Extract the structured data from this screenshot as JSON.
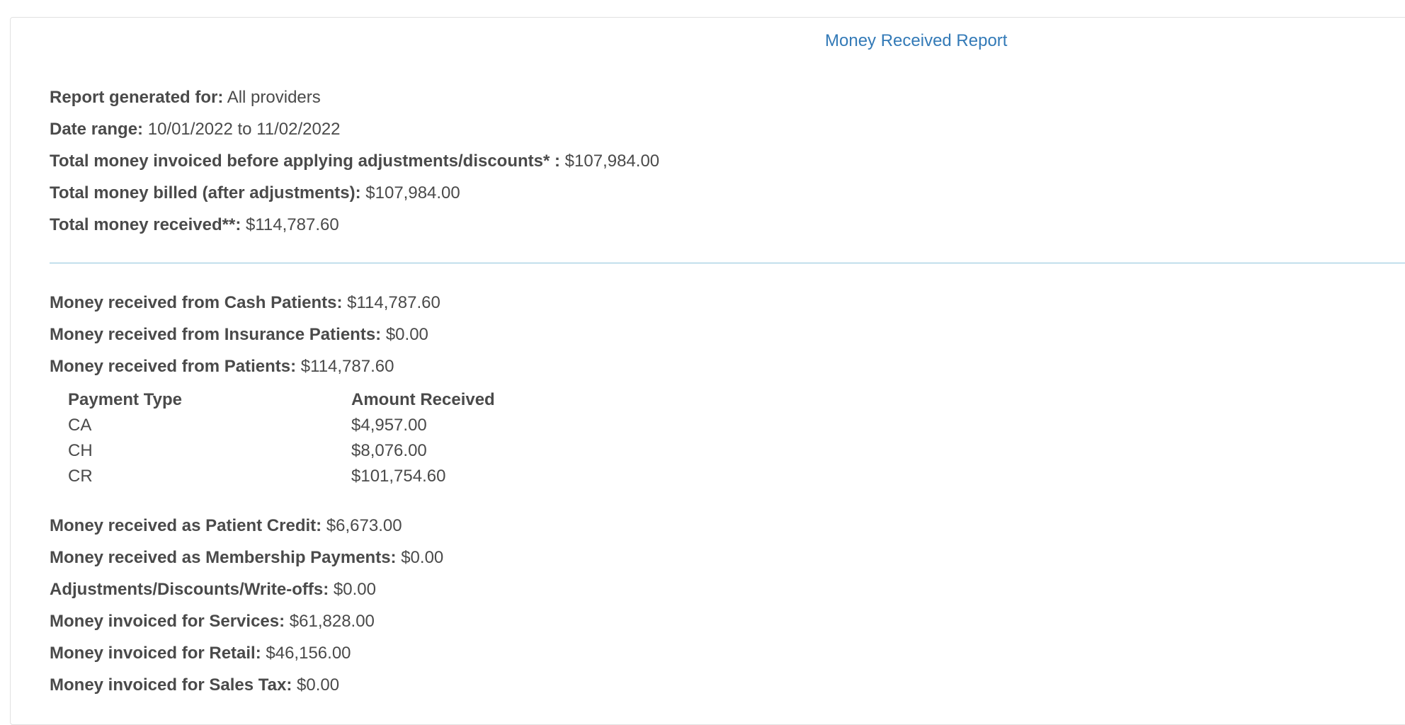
{
  "report": {
    "title": "Money Received Report"
  },
  "summary": [
    {
      "label": "Report generated for:",
      "value": "All providers"
    },
    {
      "label": "Date range:",
      "value": "10/01/2022 to 11/02/2022"
    },
    {
      "label": "Total money invoiced before applying adjustments/discounts* :",
      "value": "$107,984.00"
    },
    {
      "label": "Total money billed (after adjustments):",
      "value": "$107,984.00"
    },
    {
      "label": "Total money received**:",
      "value": "$114,787.60"
    }
  ],
  "sources": [
    {
      "label": "Money received from Cash Patients:",
      "value": "$114,787.60"
    },
    {
      "label": "Money received from Insurance Patients:",
      "value": "$0.00"
    },
    {
      "label": "Money received from Patients:",
      "value": "$114,787.60"
    }
  ],
  "payment_table": {
    "headers": [
      "Payment Type",
      "Amount Received"
    ],
    "rows": [
      [
        "CA",
        "$4,957.00"
      ],
      [
        "CH",
        "$8,076.00"
      ],
      [
        "CR",
        "$101,754.60"
      ]
    ]
  },
  "details": [
    {
      "label": "Money received as Patient Credit:",
      "value": "$6,673.00"
    },
    {
      "label": "Money received as Membership Payments:",
      "value": "$0.00"
    },
    {
      "label": "Adjustments/Discounts/Write-offs:",
      "value": "$0.00"
    },
    {
      "label": "Money invoiced for Services:",
      "value": "$61,828.00"
    },
    {
      "label": "Money invoiced for Retail:",
      "value": "$46,156.00"
    },
    {
      "label": "Money invoiced for Sales Tax:",
      "value": "$0.00"
    }
  ]
}
